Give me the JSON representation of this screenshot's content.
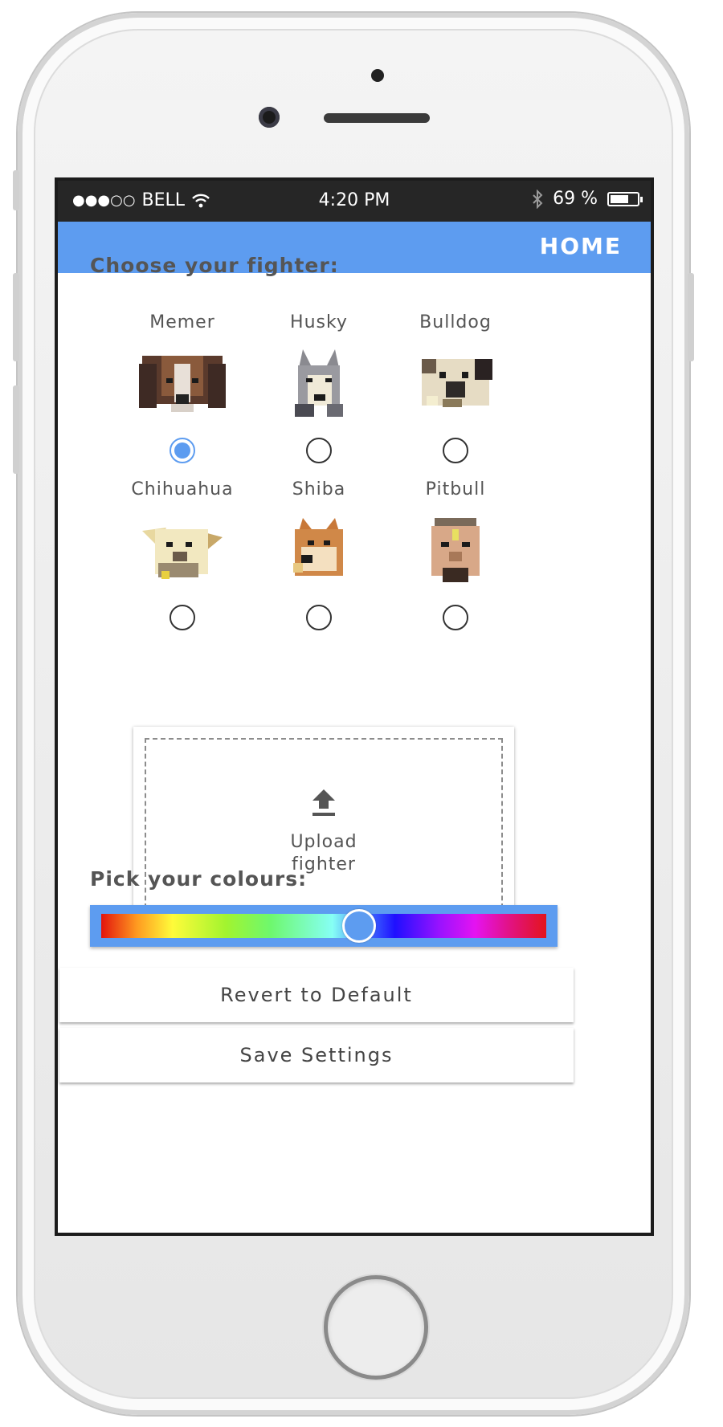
{
  "status_bar": {
    "carrier": "BELL",
    "signal": "●●●○○",
    "time": "4:20 PM",
    "battery": "69 %",
    "battery_level": 0.69
  },
  "nav": {
    "home_label": "HOME"
  },
  "fighter_section": {
    "title": "Choose your fighter:",
    "selected": "Memer",
    "fighters": [
      {
        "name": "Memer"
      },
      {
        "name": "Husky"
      },
      {
        "name": "Bulldog"
      },
      {
        "name": "Chihuahua"
      },
      {
        "name": "Shiba"
      },
      {
        "name": "Pitbull"
      }
    ]
  },
  "upload": {
    "label_line1": "Upload",
    "label_line2": "fighter"
  },
  "colour_section": {
    "title": "Pick your colours:",
    "hue_value": 0.58
  },
  "actions": {
    "revert_label": "Revert to Default",
    "save_label": "Save Settings"
  }
}
